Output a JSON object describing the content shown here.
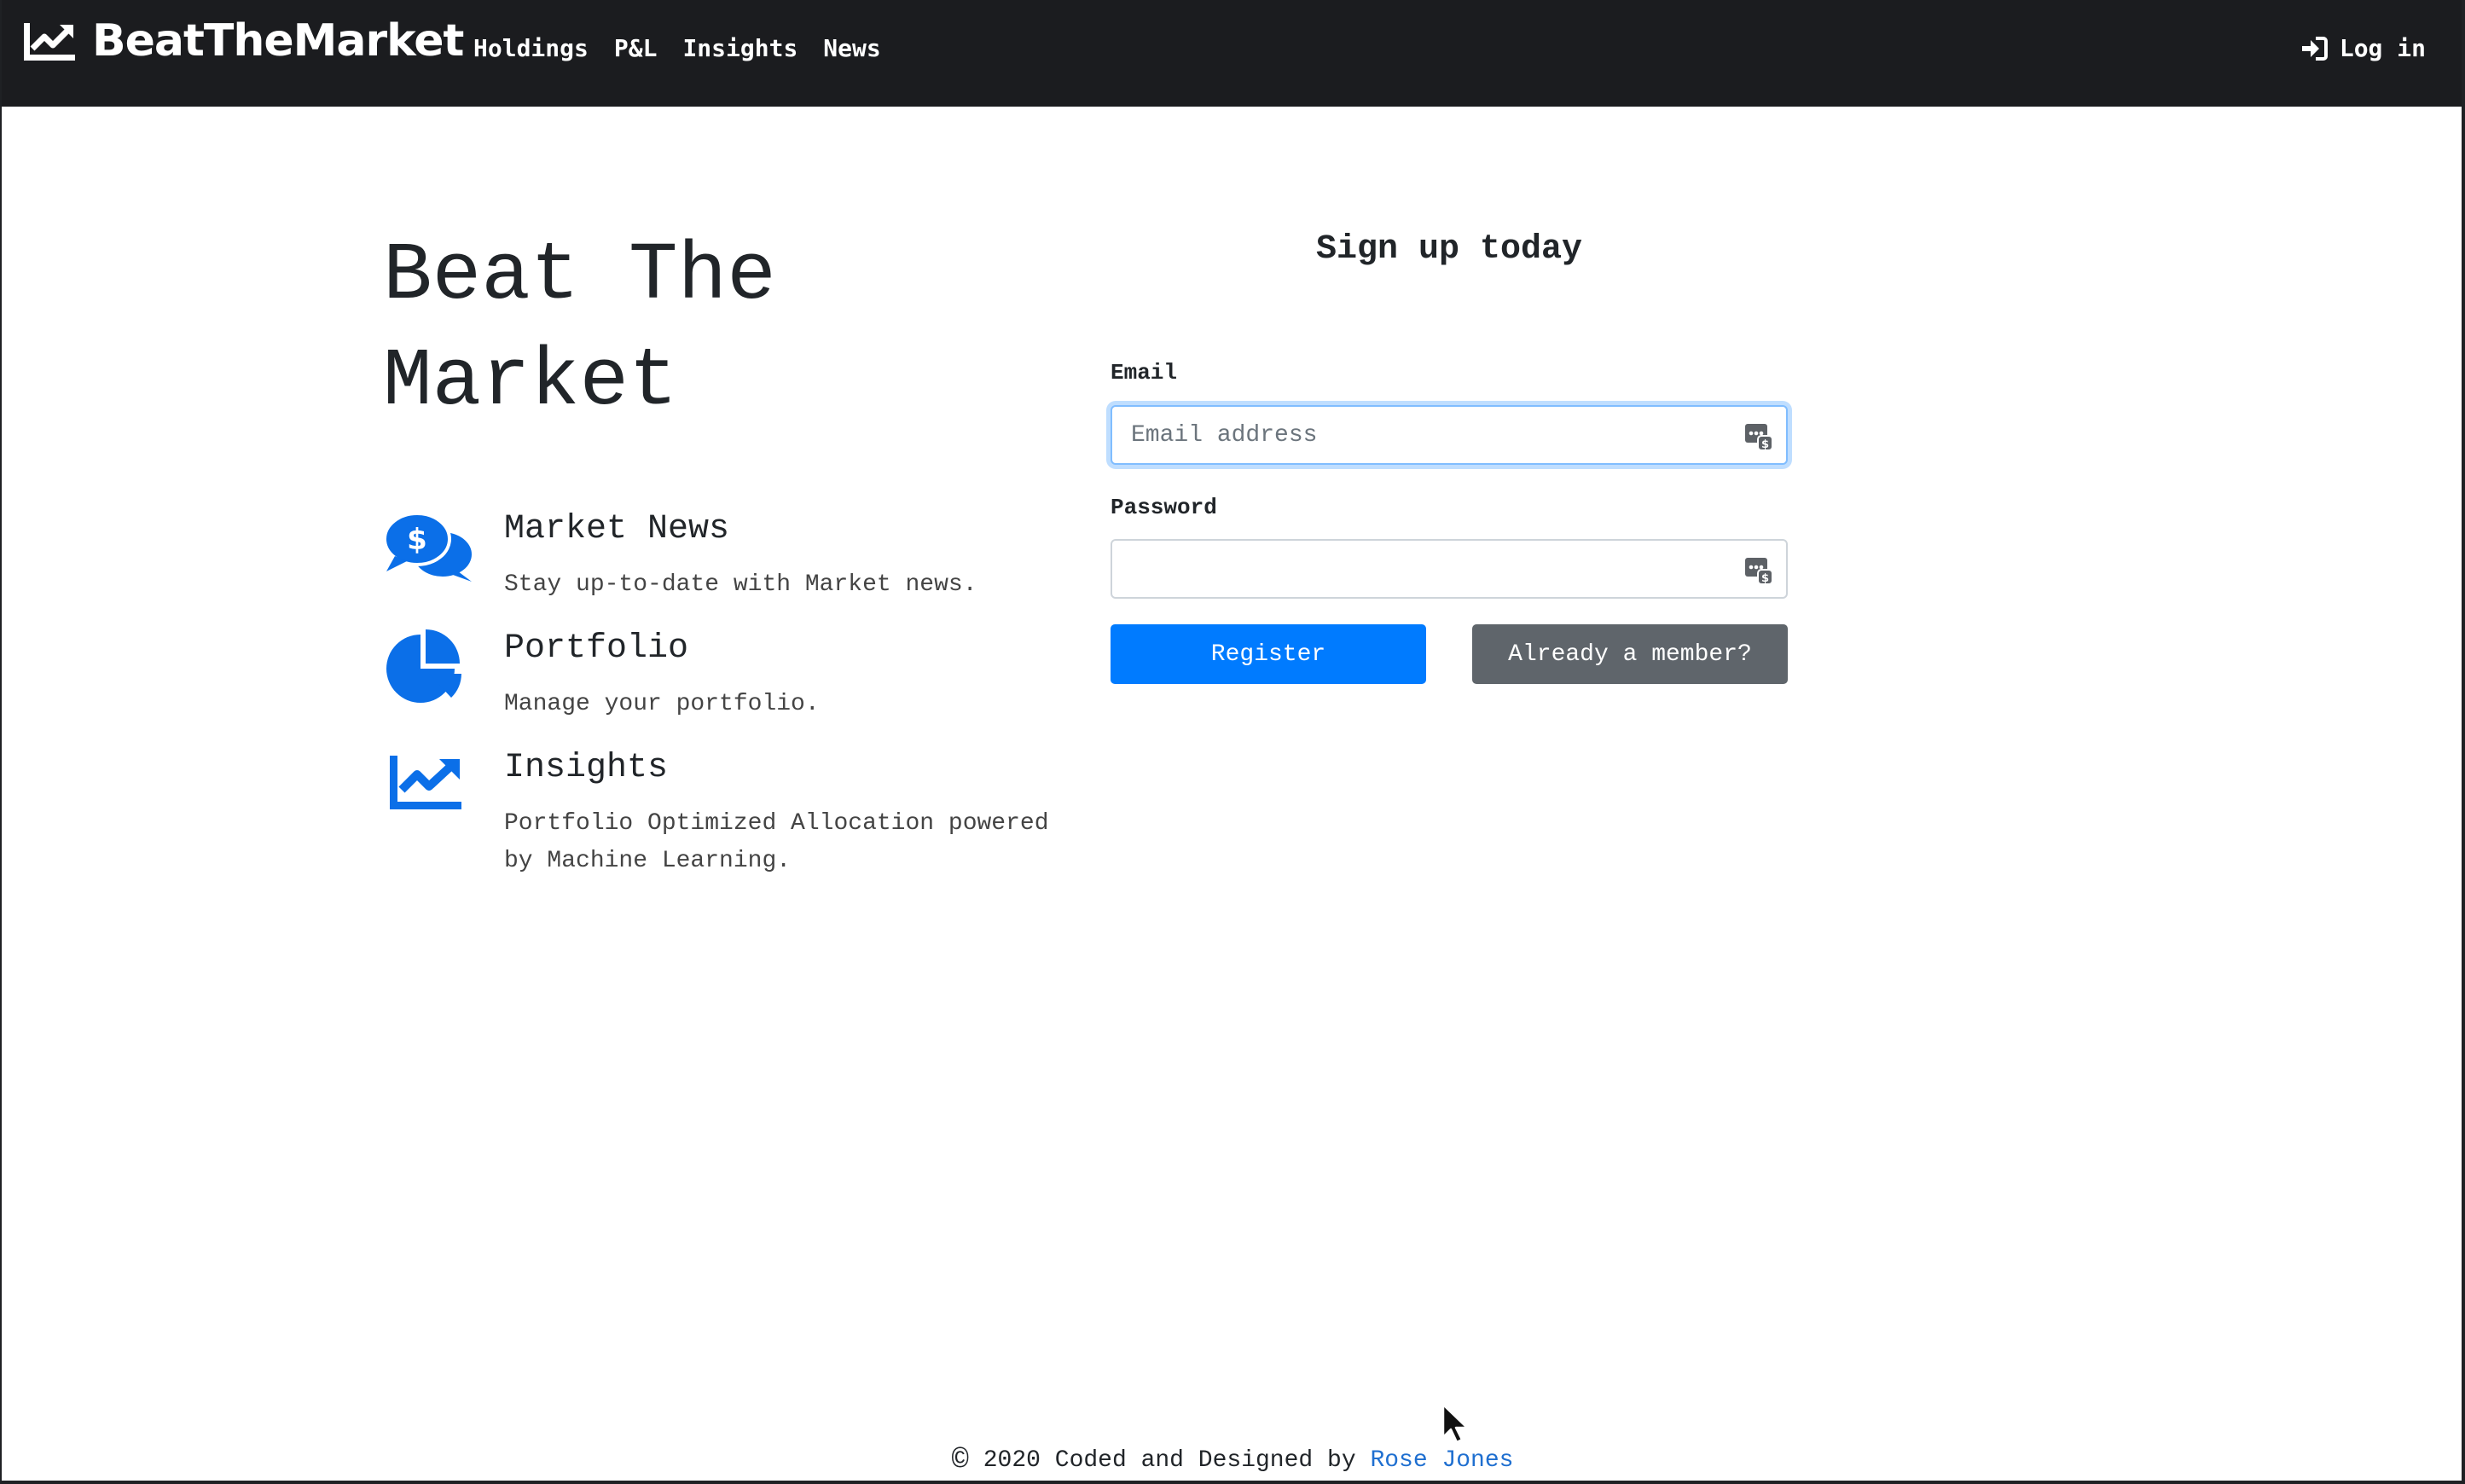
{
  "navbar": {
    "brand": "BeatTheMarket",
    "links": [
      "Holdings",
      "P&L",
      "Insights",
      "News"
    ],
    "login": "Log in"
  },
  "hero": {
    "title_line1": "Beat The",
    "title_line2": "Market"
  },
  "features": [
    {
      "icon": "chat-dollar-icon",
      "title": "Market News",
      "desc": "Stay up-to-date with Market news."
    },
    {
      "icon": "pie-chart-icon",
      "title": "Portfolio",
      "desc": "Manage your portfolio."
    },
    {
      "icon": "chart-line-icon",
      "title": "Insights",
      "desc": "Portfolio Optimized Allocation powered by Machine Learning."
    }
  ],
  "signup": {
    "title": "Sign up today",
    "email_label": "Email",
    "email_placeholder": "Email address",
    "email_value": "",
    "password_label": "Password",
    "password_value": "",
    "register": "Register",
    "member": "Already a member?"
  },
  "footer": {
    "copyright_symbol": "©",
    "text": "2020 Coded and Designed by",
    "author": "Rose Jones"
  },
  "colors": {
    "navbar_bg": "#1b1c1f",
    "accent": "#007bff",
    "secondary": "#5f656b",
    "link": "#1f6fd0"
  }
}
